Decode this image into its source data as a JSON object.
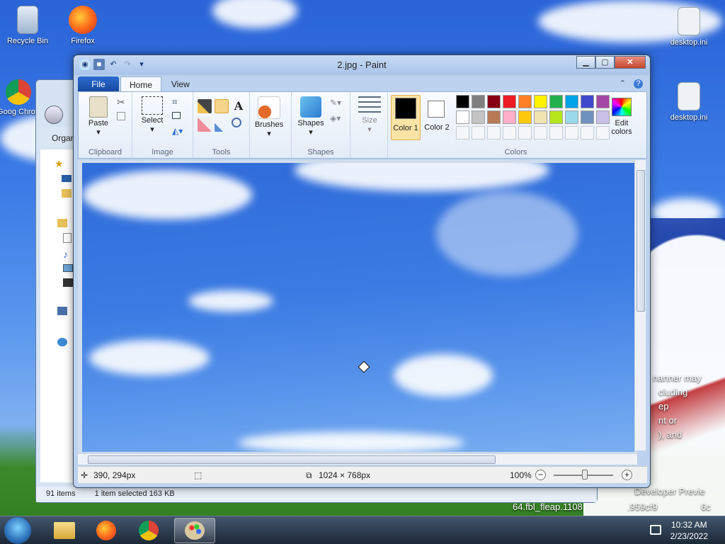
{
  "desktop": {
    "icons": [
      {
        "label": "Recycle Bin",
        "name": "recycle-bin-icon"
      },
      {
        "label": "Firefox",
        "name": "firefox-icon"
      },
      {
        "label": "Goog Chron",
        "name": "chrome-icon"
      },
      {
        "label": "desktop.ini",
        "name": "settings-file-icon"
      },
      {
        "label": "desktop.ini",
        "name": "settings-file-icon"
      }
    ],
    "overlay_text": [
      "nanner may",
      "cluding",
      "ep",
      "nt or",
      "), and",
      "Developer Previe",
      "64.fbl_fleap.1108",
      ".959cf9",
      "6c"
    ]
  },
  "explorer": {
    "organize_label": "Organ",
    "status_items": "91 items",
    "status_selected": "1 item selected  163 KB"
  },
  "paint": {
    "title": "2.jpg - Paint",
    "tabs": {
      "file": "File",
      "home": "Home",
      "view": "View"
    },
    "clipboard": {
      "paste": "Paste",
      "group": "Clipboard"
    },
    "image": {
      "select": "Select",
      "group": "Image"
    },
    "tools": {
      "group": "Tools"
    },
    "brushes": {
      "label": "Brushes"
    },
    "shapes": {
      "label": "Shapes",
      "group": "Shapes"
    },
    "size": {
      "label": "Size"
    },
    "colors": {
      "color1": "Color 1",
      "color2": "Color 2",
      "edit": "Edit colors",
      "group": "Colors",
      "color1_value": "#000000",
      "color2_value": "#ffffff",
      "palette_row1": [
        "#000000",
        "#7f7f7f",
        "#880015",
        "#ed1c24",
        "#ff7f27",
        "#fff200",
        "#22b14c",
        "#00a2e8",
        "#3f48cc",
        "#a349a4"
      ],
      "palette_row2": [
        "#ffffff",
        "#c3c3c3",
        "#b97a57",
        "#ffaec9",
        "#ffc90e",
        "#efe4b0",
        "#b5e61d",
        "#99d9ea",
        "#7092be",
        "#c8bfe7"
      ]
    },
    "status": {
      "cursor": "390, 294px",
      "image_size": "1024 × 768px",
      "zoom": "100%"
    }
  },
  "taskbar": {
    "time": "10:32 AM",
    "date": "2/23/2022",
    "items": [
      "Windows Explorer",
      "Firefox",
      "Chrome",
      "Paint"
    ]
  }
}
